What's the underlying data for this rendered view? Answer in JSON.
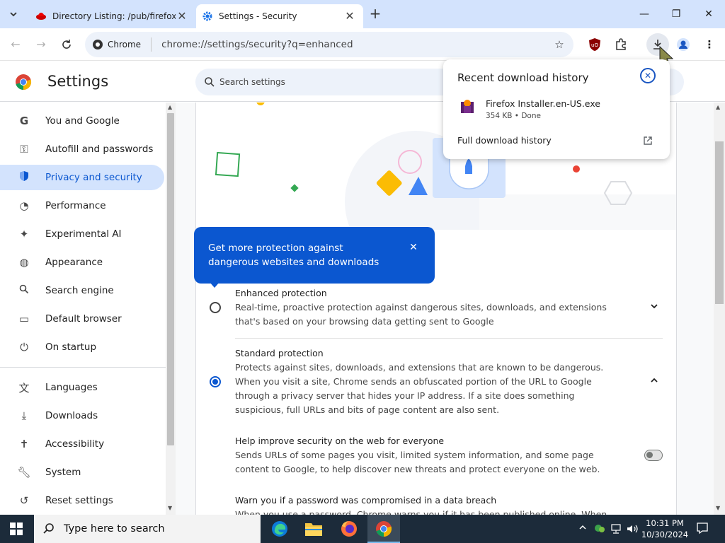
{
  "tabs": [
    {
      "title": "Directory Listing: /pub/firefox/re",
      "active": false
    },
    {
      "title": "Settings - Security",
      "active": true
    }
  ],
  "omnibox": {
    "chip": "Chrome",
    "url": "chrome://settings/security?q=enhanced"
  },
  "settings": {
    "title": "Settings",
    "search_placeholder": "Search settings"
  },
  "sidebar": {
    "items": [
      {
        "label": "You and Google",
        "icon": "google-icon"
      },
      {
        "label": "Autofill and passwords",
        "icon": "key-icon"
      },
      {
        "label": "Privacy and security",
        "icon": "shield-icon",
        "active": true
      },
      {
        "label": "Performance",
        "icon": "speedometer-icon"
      },
      {
        "label": "Experimental AI",
        "icon": "sparkle-icon"
      },
      {
        "label": "Appearance",
        "icon": "palette-icon"
      },
      {
        "label": "Search engine",
        "icon": "search-icon"
      },
      {
        "label": "Default browser",
        "icon": "browser-window-icon"
      },
      {
        "label": "On startup",
        "icon": "power-icon"
      },
      {
        "label": "Languages",
        "icon": "translate-icon"
      },
      {
        "label": "Downloads",
        "icon": "download-icon"
      },
      {
        "label": "Accessibility",
        "icon": "accessibility-icon"
      },
      {
        "label": "System",
        "icon": "wrench-icon"
      },
      {
        "label": "Reset settings",
        "icon": "reset-icon"
      }
    ]
  },
  "callout": {
    "text": "Get more protection against dangerous websites and downloads"
  },
  "options": {
    "enhanced": {
      "title": "Enhanced protection",
      "desc": "Real-time, proactive protection against dangerous sites, downloads, and extensions that's based on your browsing data getting sent to Google",
      "selected": false
    },
    "standard": {
      "title": "Standard protection",
      "desc": "Protects against sites, downloads, and extensions that are known to be dangerous. When you visit a site, Chrome sends an obfuscated portion of the URL to Google through a privacy server that hides your IP address. If a site does something suspicious, full URLs and bits of page content are also sent.",
      "selected": true
    },
    "help_improve": {
      "title": "Help improve security on the web for everyone",
      "desc": "Sends URLs of some pages you visit, limited system information, and some page content to Google, to help discover new threats and protect everyone on the web.",
      "enabled": false
    },
    "password_breach": {
      "title": "Warn you if a password was compromised in a data breach",
      "desc": "When you use a password, Chrome warns you if it has been published online. When doing this,"
    }
  },
  "downloads": {
    "heading": "Recent download history",
    "file_name": "Firefox Installer.en-US.exe",
    "file_meta": "354 KB • Done",
    "full_history_link": "Full download history"
  },
  "taskbar": {
    "search_placeholder": "Type here to search",
    "time": "10:31 PM",
    "date": "10/30/2024"
  },
  "colors": {
    "accent": "#0b57d0",
    "tabstrip": "#d3e3fd",
    "taskbar": "#1c2b3a"
  }
}
